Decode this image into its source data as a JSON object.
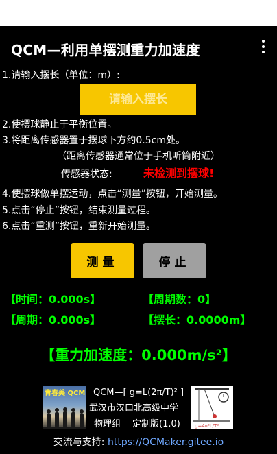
{
  "app": {
    "title": "QCM—利用单摆测重力加速度",
    "menu_icon": "more-vertical-icon"
  },
  "steps": {
    "step1": "1.请输入摆长（单位：m）:",
    "length_placeholder": "请输入摆长",
    "step2": "2.使摆球静止于平衡位置。",
    "step3": "3.将距离传感器置于摆球下方约0.5cm处。",
    "step3_note": "（距离传感器通常位于手机听筒附近）",
    "sensor_label": "传感器状态:",
    "sensor_status": "未检测到摆球!",
    "step4": "4.使摆球做单摆运动，点击“测量”按钮，开始测量。",
    "step5": "5.点击“停止”按钮，结束测量过程。",
    "step6": "6.点击“重测”按钮，重新开始测量。"
  },
  "buttons": {
    "measure": "测量",
    "stop": "停止"
  },
  "results": {
    "time": "【时间：0.000s】",
    "cycles": "【周期数：0】",
    "period": "【周期：0.000s】",
    "length": "【摆长：0.0000m】",
    "gravity": "【重力加速度：0.000m/s²】"
  },
  "info": {
    "logo_text": "青春美 QCM",
    "formula": "QCM—[ g=L(2π/T)² ]",
    "school": "武汉市汉口北高级中学",
    "group": "物理组",
    "version": "定制版(1.0)",
    "diagram_formula": "g=4π²L/T²"
  },
  "footer": {
    "label": "交流与支持: ",
    "link": "https://QCMaker.gitee.io"
  },
  "colors": {
    "accent_yellow": "#f7c600",
    "result_green": "#00ff00",
    "warning_red": "#ff0000",
    "button_gray": "#a0a0a0",
    "link_blue": "#6fa8ff"
  }
}
